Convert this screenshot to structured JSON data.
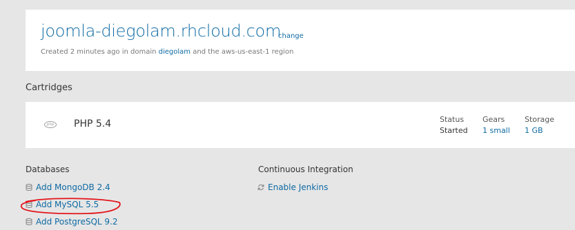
{
  "app": {
    "title": "joomla-diegolam.rhcloud.com",
    "change_label": "change",
    "meta_prefix": "Created 2 minutes ago in domain ",
    "domain": "diegolam",
    "meta_suffix": " and the aws-us-east-1 region"
  },
  "cartridges": {
    "heading": "Cartridges",
    "items": [
      {
        "icon": "php-icon",
        "icon_text": "php",
        "name": "PHP 5.4",
        "status_label": "Status",
        "status_value": "Started",
        "gears_label": "Gears",
        "gears_value": "1 small",
        "storage_label": "Storage",
        "storage_value": "1 GB"
      }
    ]
  },
  "databases": {
    "heading": "Databases",
    "items": [
      {
        "label": "Add MongoDB 2.4",
        "icon": "database-icon"
      },
      {
        "label": "Add MySQL 5.5",
        "icon": "database-icon"
      },
      {
        "label": "Add PostgreSQL 9.2",
        "icon": "database-icon"
      }
    ]
  },
  "continuous_integration": {
    "heading": "Continuous Integration",
    "items": [
      {
        "label": "Enable Jenkins",
        "icon": "refresh-icon"
      }
    ]
  },
  "colors": {
    "link": "#0e6aa3",
    "background": "#e6e6e6",
    "card": "#ffffff",
    "annotation": "#e3151a"
  }
}
